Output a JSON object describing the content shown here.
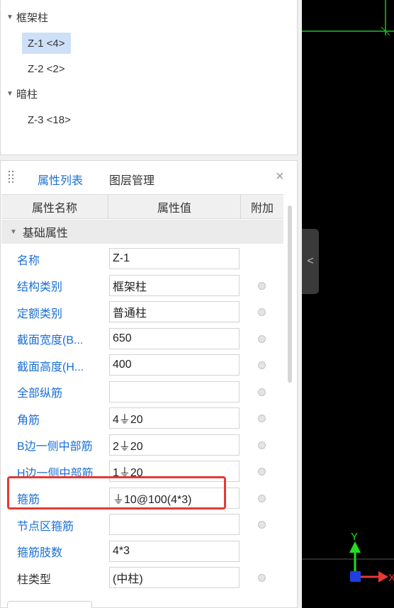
{
  "tree": {
    "groups": [
      {
        "label": "框架柱",
        "items": [
          {
            "label": "Z-1 <4>",
            "selected": true
          },
          {
            "label": "Z-2 <2>",
            "selected": false
          }
        ]
      },
      {
        "label": "暗柱",
        "items": [
          {
            "label": "Z-3 <18>",
            "selected": false
          }
        ]
      }
    ]
  },
  "properties_panel": {
    "tabs": [
      {
        "label": "属性列表",
        "active": true
      },
      {
        "label": "图层管理",
        "active": false
      }
    ],
    "close_glyph": "×",
    "columns": {
      "name": "属性名称",
      "value": "属性值",
      "extra": "附加"
    },
    "section": "基础属性",
    "rows": [
      {
        "name": "名称",
        "value": "Z-1",
        "has_dot": false,
        "name_style": "link"
      },
      {
        "name": "结构类别",
        "value": "框架柱",
        "has_dot": true,
        "name_style": "link"
      },
      {
        "name": "定额类别",
        "value": "普通柱",
        "has_dot": true,
        "name_style": "link"
      },
      {
        "name": "截面宽度(B...",
        "value": "650",
        "has_dot": true,
        "name_style": "link"
      },
      {
        "name": "截面高度(H...",
        "value": "400",
        "has_dot": true,
        "name_style": "link"
      },
      {
        "name": "全部纵筋",
        "value": "",
        "has_dot": true,
        "name_style": "link"
      },
      {
        "name": "角筋",
        "value": "4⏚20",
        "has_dot": true,
        "name_style": "link"
      },
      {
        "name": "B边一侧中部筋",
        "value": "2⏚20",
        "has_dot": true,
        "name_style": "link"
      },
      {
        "name": "H边一侧中部筋",
        "value": "1⏚20",
        "has_dot": true,
        "name_style": "link"
      },
      {
        "name": "箍筋",
        "value": "⏚10@100(4*3)",
        "has_dot": true,
        "name_style": "link"
      },
      {
        "name": "节点区箍筋",
        "value": "",
        "has_dot": true,
        "name_style": "link"
      },
      {
        "name": "箍筋肢数",
        "value": "4*3",
        "has_dot": false,
        "name_style": "link"
      },
      {
        "name": "柱类型",
        "value": "(中柱)",
        "has_dot": true,
        "name_style": "plain"
      }
    ]
  },
  "canvas": {
    "background": "#000000",
    "axis_y_label": "Y",
    "axis_x_label": "X",
    "colors": {
      "grid_line": "#1fc11f",
      "axis_y": "#22dd22",
      "axis_x": "#e53935",
      "origin": "#1f3fe0",
      "highlight": "#e53935",
      "accent": "#1a6fd6"
    }
  },
  "collapse_glyph": "<"
}
